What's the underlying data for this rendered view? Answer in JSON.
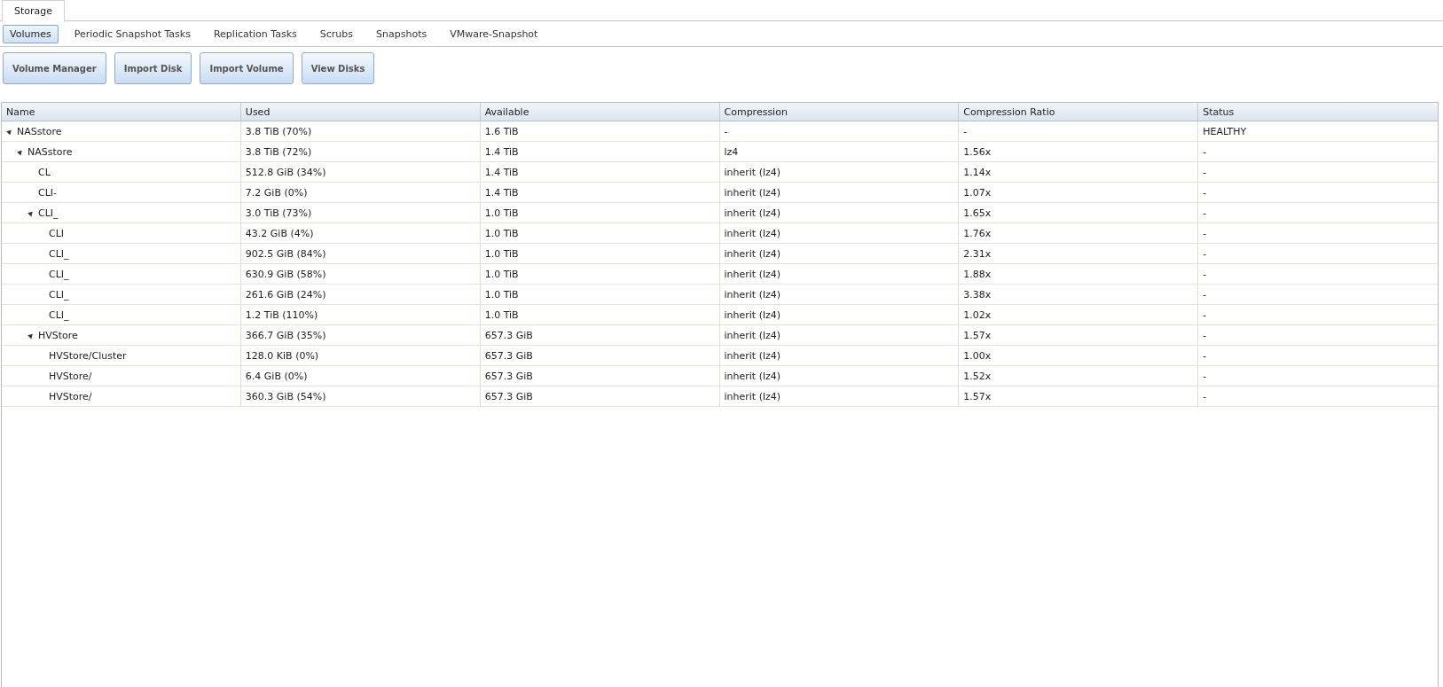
{
  "top_tabs": [
    {
      "label": "Storage",
      "selected": true
    }
  ],
  "sub_tabs": [
    {
      "label": "Volumes",
      "selected": true
    },
    {
      "label": "Periodic Snapshot Tasks",
      "selected": false
    },
    {
      "label": "Replication Tasks",
      "selected": false
    },
    {
      "label": "Scrubs",
      "selected": false
    },
    {
      "label": "Snapshots",
      "selected": false
    },
    {
      "label": "VMware-Snapshot",
      "selected": false
    }
  ],
  "buttons": [
    "Volume Manager",
    "Import Disk",
    "Import Volume",
    "View Disks"
  ],
  "table": {
    "columns": [
      "Name",
      "Used",
      "Available",
      "Compression",
      "Compression Ratio",
      "Status"
    ],
    "rows": [
      {
        "name": "NASstore",
        "used": "3.8 TiB (70%)",
        "available": "1.6 TiB",
        "compression": "-",
        "ratio": "-",
        "status": "HEALTHY",
        "expanded": true,
        "children": [
          {
            "name": "NASstore",
            "used": "3.8 TiB (72%)",
            "available": "1.4 TiB",
            "compression": "lz4",
            "ratio": "1.56x",
            "status": "-",
            "expanded": true,
            "children": [
              {
                "name": "CL",
                "used": "512.8 GiB (34%)",
                "available": "1.4 TiB",
                "compression": "inherit (lz4)",
                "ratio": "1.14x",
                "status": "-"
              },
              {
                "name": "CLI-",
                "used": "7.2 GiB (0%)",
                "available": "1.4 TiB",
                "compression": "inherit (lz4)",
                "ratio": "1.07x",
                "status": "-"
              },
              {
                "name": "CLI_",
                "used": "3.0 TiB (73%)",
                "available": "1.0 TiB",
                "compression": "inherit (lz4)",
                "ratio": "1.65x",
                "status": "-",
                "expanded": true,
                "children": [
                  {
                    "name": "CLI",
                    "used": "43.2 GiB (4%)",
                    "available": "1.0 TiB",
                    "compression": "inherit (lz4)",
                    "ratio": "1.76x",
                    "status": "-"
                  },
                  {
                    "name": "CLI_",
                    "used": "902.5 GiB (84%)",
                    "available": "1.0 TiB",
                    "compression": "inherit (lz4)",
                    "ratio": "2.31x",
                    "status": "-"
                  },
                  {
                    "name": "CLI_",
                    "used": "630.9 GiB (58%)",
                    "available": "1.0 TiB",
                    "compression": "inherit (lz4)",
                    "ratio": "1.88x",
                    "status": "-"
                  },
                  {
                    "name": "CLI_",
                    "used": "261.6 GiB (24%)",
                    "available": "1.0 TiB",
                    "compression": "inherit (lz4)",
                    "ratio": "3.38x",
                    "status": "-"
                  },
                  {
                    "name": "CLI_",
                    "used": "1.2 TiB (110%)",
                    "available": "1.0 TiB",
                    "compression": "inherit (lz4)",
                    "ratio": "1.02x",
                    "status": "-"
                  }
                ]
              },
              {
                "name": "HVStore",
                "used": "366.7 GiB (35%)",
                "available": "657.3 GiB",
                "compression": "inherit (lz4)",
                "ratio": "1.57x",
                "status": "-",
                "expanded": true,
                "children": [
                  {
                    "name": "HVStore/Cluster",
                    "used": "128.0 KiB (0%)",
                    "available": "657.3 GiB",
                    "compression": "inherit (lz4)",
                    "ratio": "1.00x",
                    "status": "-"
                  },
                  {
                    "name": "HVStore/",
                    "used": "6.4 GiB (0%)",
                    "available": "657.3 GiB",
                    "compression": "inherit (lz4)",
                    "ratio": "1.52x",
                    "status": "-"
                  },
                  {
                    "name": "HVStore/",
                    "used": "360.3 GiB (54%)",
                    "available": "657.3 GiB",
                    "compression": "inherit (lz4)",
                    "ratio": "1.57x",
                    "status": "-"
                  }
                ]
              }
            ]
          }
        ]
      }
    ]
  }
}
